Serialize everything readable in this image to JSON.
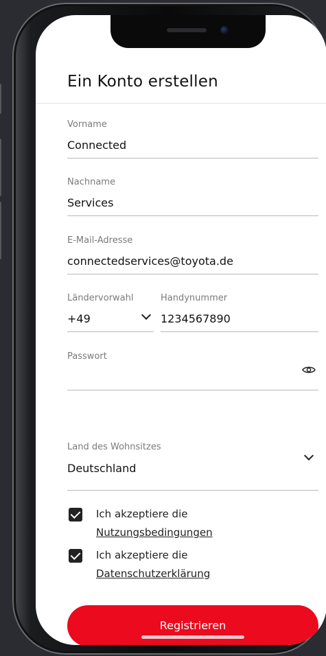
{
  "page": {
    "title": "Ein Konto erstellen"
  },
  "form": {
    "first_name": {
      "label": "Vorname",
      "value": "Connected"
    },
    "last_name": {
      "label": "Nachname",
      "value": "Services"
    },
    "email": {
      "label": "E-Mail-Adresse",
      "value": "connectedservices@toyota.de"
    },
    "country_code": {
      "label": "Ländervorwahl",
      "value": "+49"
    },
    "mobile": {
      "label": "Handynummer",
      "value": "1234567890"
    },
    "password": {
      "label": "Passwort",
      "value": ""
    },
    "residence": {
      "label": "Land des Wohnsitzes",
      "value": "Deutschland"
    }
  },
  "consents": [
    {
      "text": "Ich akzeptiere die",
      "link": "Nutzungsbedingungen",
      "checked": true
    },
    {
      "text": "Ich akzeptiere die",
      "link": "Datenschutzerklärung",
      "checked": true
    }
  ],
  "actions": {
    "register_label": "Registrieren"
  },
  "colors": {
    "accent": "#eb0a1e",
    "frame": "#0a0a0b",
    "background": "#2a2c32"
  }
}
